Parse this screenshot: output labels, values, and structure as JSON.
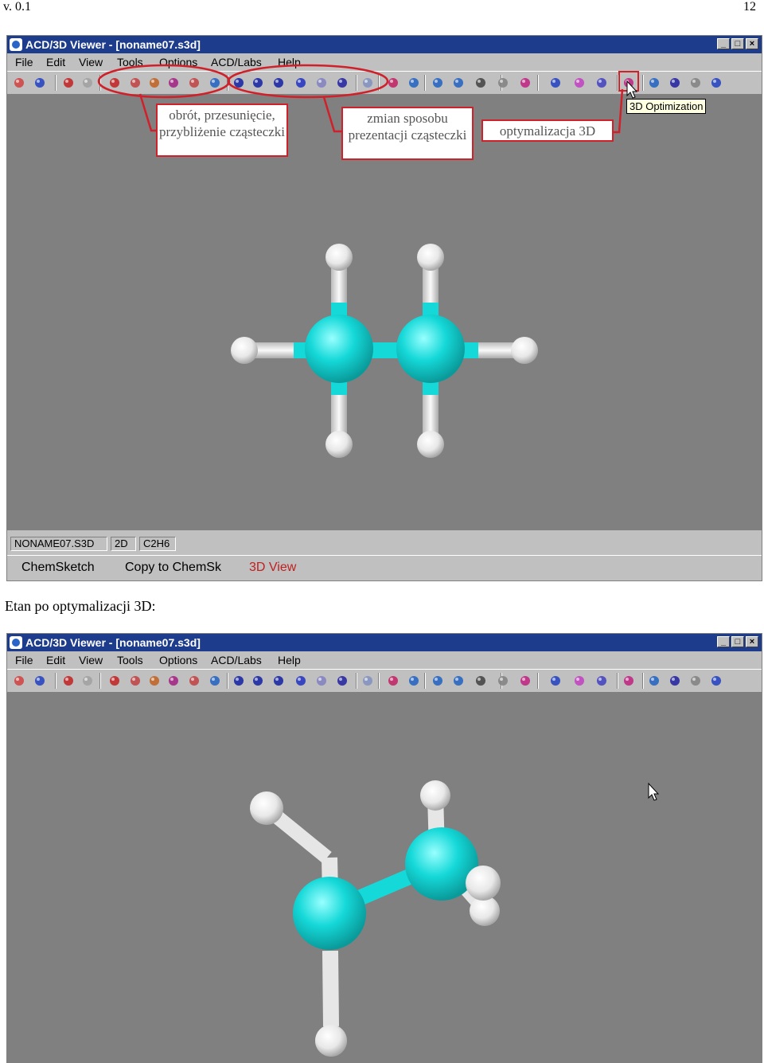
{
  "page": {
    "version": "v. 0.1",
    "page_number": "12",
    "caption": "Etan po optymalizacji 3D:"
  },
  "window": {
    "title": "ACD/3D Viewer - [noname07.s3d]",
    "menu": [
      "File",
      "Edit",
      "View",
      "Tools",
      "Options",
      "ACD/Labs",
      "Help"
    ],
    "controls": {
      "minimize": "_",
      "maximize": "□",
      "close": "×"
    }
  },
  "status": {
    "filename": "NONAME07.S3D",
    "mode": "2D",
    "formula": "C2H6"
  },
  "bottom": {
    "chemsketch": "ChemSketch",
    "copy": "Copy to ChemSk",
    "view3d": "3D View"
  },
  "annotations": {
    "rotate": "obrót, przesunięcie, przybliżenie cząsteczki",
    "display": "zmian sposobu prezentacji cząsteczki",
    "optimize": "optymalizacja 3D",
    "tooltip": "3D Optimization"
  },
  "colors": {
    "atom_c": "#15d8d8",
    "atom_h": "#f2f2f2",
    "canvas": "#808080",
    "annotation": "#d0202a"
  }
}
